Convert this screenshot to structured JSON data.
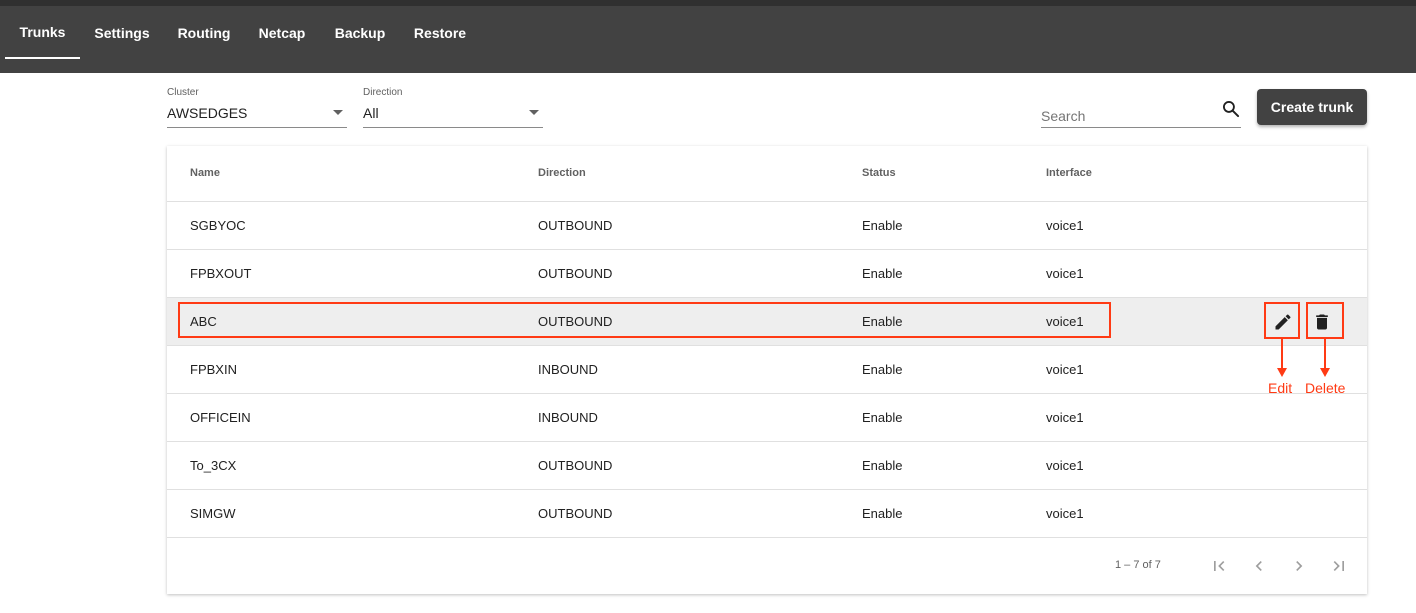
{
  "nav": {
    "tabs": [
      {
        "label": "Trunks",
        "active": true
      },
      {
        "label": "Settings",
        "active": false
      },
      {
        "label": "Routing",
        "active": false
      },
      {
        "label": "Netcap",
        "active": false
      },
      {
        "label": "Backup",
        "active": false
      },
      {
        "label": "Restore",
        "active": false
      }
    ]
  },
  "filters": {
    "cluster": {
      "label": "Cluster",
      "value": "AWSEDGES"
    },
    "direction": {
      "label": "Direction",
      "value": "All"
    }
  },
  "search": {
    "placeholder": "Search",
    "icon": "search-icon"
  },
  "create_button": {
    "label": "Create trunk"
  },
  "table": {
    "columns": [
      "Name",
      "Direction",
      "Status",
      "Interface"
    ],
    "rows": [
      {
        "name": "SGBYOC",
        "direction": "OUTBOUND",
        "status": "Enable",
        "interface": "voice1"
      },
      {
        "name": "FPBXOUT",
        "direction": "OUTBOUND",
        "status": "Enable",
        "interface": "voice1"
      },
      {
        "name": "ABC",
        "direction": "OUTBOUND",
        "status": "Enable",
        "interface": "voice1"
      },
      {
        "name": "FPBXIN",
        "direction": "INBOUND",
        "status": "Enable",
        "interface": "voice1"
      },
      {
        "name": "OFFICEIN",
        "direction": "INBOUND",
        "status": "Enable",
        "interface": "voice1"
      },
      {
        "name": "To_3CX",
        "direction": "OUTBOUND",
        "status": "Enable",
        "interface": "voice1"
      },
      {
        "name": "SIMGW",
        "direction": "OUTBOUND",
        "status": "Enable",
        "interface": "voice1"
      }
    ]
  },
  "paginator": {
    "range_label": "1 – 7 of 7"
  },
  "annotations": {
    "edit_label": "Edit",
    "delete_label": "Delete",
    "color": "#ff3a14"
  },
  "colors": {
    "topbar": "#424242",
    "button": "#424242",
    "row_highlight": "#eeeeee"
  }
}
